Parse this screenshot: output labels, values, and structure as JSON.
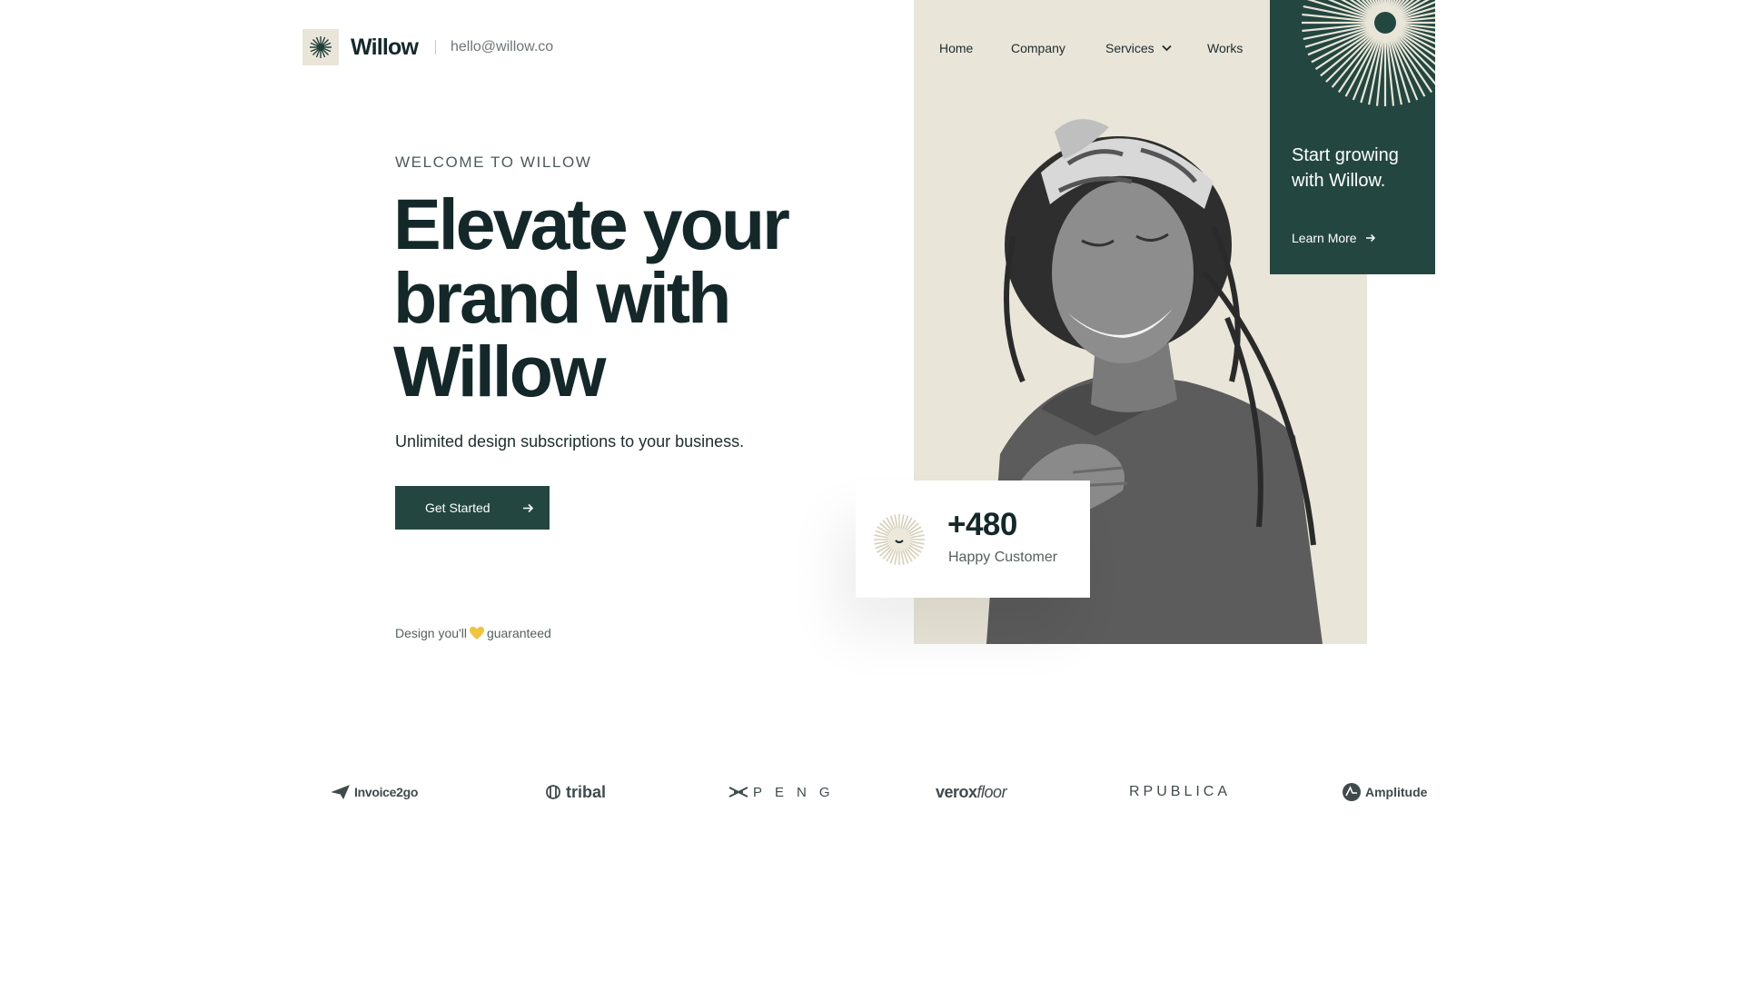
{
  "header": {
    "brand": "Willow",
    "email": "hello@willow.co"
  },
  "nav": {
    "home": "Home",
    "company": "Company",
    "services": "Services",
    "works": "Works"
  },
  "promo": {
    "title": "Start growing with Willow.",
    "link": "Learn More"
  },
  "hero": {
    "eyebrow": "WELCOME TO WILLOW",
    "headline": "Elevate your brand with Willow",
    "subtext": "Unlimited design subscriptions to your business.",
    "cta": "Get Started",
    "guarantee_before": "Design you'll",
    "guarantee_after": "guaranteed"
  },
  "stat": {
    "value": "+480",
    "label": "Happy Customer"
  },
  "logos": {
    "invoice": "Invoice2go",
    "tribal": "tribal",
    "peng": "PENG",
    "verox_a": "verox",
    "verox_b": "floor",
    "rpublica": "RPUBLICA",
    "amplitude": "Amplitude"
  },
  "colors": {
    "primary_green": "#234740",
    "beige": "#e9e5d8",
    "text_dark": "#14282a"
  },
  "icons": [
    "sunburst-icon",
    "chevron-down-icon",
    "arrow-right-icon",
    "heart-icon",
    "smile-sun-icon"
  ]
}
